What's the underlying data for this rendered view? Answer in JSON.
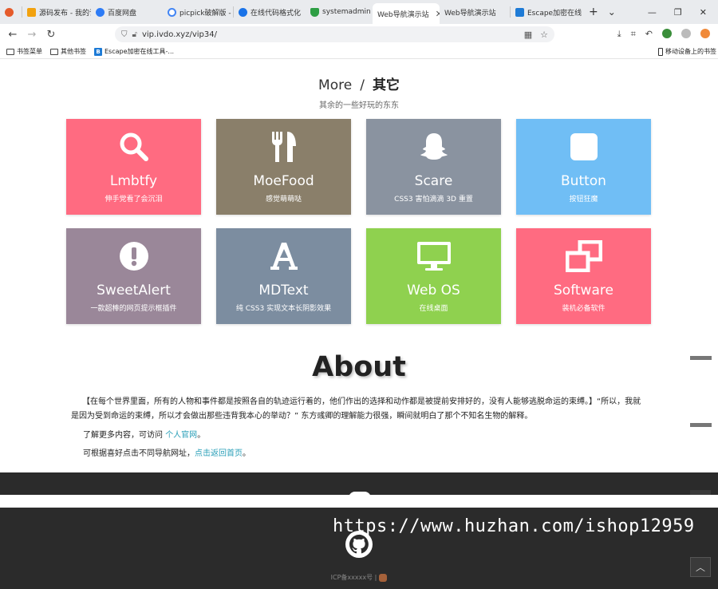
{
  "browser": {
    "tabs": [
      {
        "label": "",
        "color": "#e55b2b",
        "active": false
      },
      {
        "label": "源码发布 - 我的订",
        "color": "#f2a20f",
        "active": false
      },
      {
        "label": "百度网盘",
        "color": "#2e7cf6",
        "active": false
      },
      {
        "label": "picpick破解版 -",
        "color": "#4285f4",
        "active": false
      },
      {
        "label": "在线代码格式化",
        "color": "#1a73e8",
        "active": false
      },
      {
        "label": "systemadmin",
        "color": "#2e9e44",
        "active": false
      },
      {
        "label": "Web导航演示站",
        "color": "",
        "active": true
      },
      {
        "label": "Web导航演示站",
        "color": "",
        "active": false
      },
      {
        "label": "Escape加密在线",
        "color": "#1e7bd6",
        "active": false
      }
    ],
    "new_tab": "+",
    "tab_list": "⌄",
    "url": "vip.ivdo.xyz/vip34/",
    "bookmarks": [
      "书签菜单",
      "其他书签",
      "Escape加密在线工具-..."
    ],
    "mobile_bookmarks": "移动设备上的书签"
  },
  "section": {
    "title_en": "More",
    "title_sep": "/",
    "title_cn": "其它",
    "subtitle": "其余的一些好玩的东东"
  },
  "cards": [
    {
      "name": "Lmbtfy",
      "desc": "伸手党看了会沉泪",
      "color": "#ff6b81",
      "icon": "search-icon"
    },
    {
      "name": "MoeFood",
      "desc": "感觉萌萌哒",
      "color": "#8a7f6a",
      "icon": "cutlery-icon"
    },
    {
      "name": "Scare",
      "desc": "CSS3 害怕滴滴 3D 重置",
      "color": "#8a93a0",
      "icon": "ghost-icon"
    },
    {
      "name": "Button",
      "desc": "按钮狂魔",
      "color": "#70bef5",
      "icon": "square-icon"
    },
    {
      "name": "SweetAlert",
      "desc": "一款超棒的网页提示框插件",
      "color": "#9a8799",
      "icon": "alert-icon"
    },
    {
      "name": "MDText",
      "desc": "纯 CSS3 实现文本长阴影效果",
      "color": "#7c8da0",
      "icon": "font-icon"
    },
    {
      "name": "Web OS",
      "desc": "在线桌面",
      "color": "#8fd14f",
      "icon": "desktop-icon"
    },
    {
      "name": "Software",
      "desc": "装机必备软件",
      "color": "#ff6b81",
      "icon": "windows-icon"
    }
  ],
  "about": {
    "title": "About",
    "paragraph": "【在每个世界里面，所有的人物和事件都是按照各自的轨迹运行着的，他们作出的选择和动作都是被提前安排好的，没有人能够逃脱命运的束缚。】“所以，我就是因为受到命运的束缚，所以才会做出那些违背我本心的举动？” 东方彧卿的理解能力很强，瞬间就明白了那个不知名生物的解释。",
    "more_prefix": "了解更多内容，可访问 ",
    "more_link": "个人官网",
    "more_suffix": "。",
    "nav_prefix": "可根据喜好点击不同导航网址，",
    "nav_link": "点击返回首页",
    "nav_suffix": "。"
  },
  "footer": {
    "watermark": "https://www.huzhan.com/ishop12959",
    "icp": "ICP备xxxxx号 |",
    "to_top": "︿"
  }
}
